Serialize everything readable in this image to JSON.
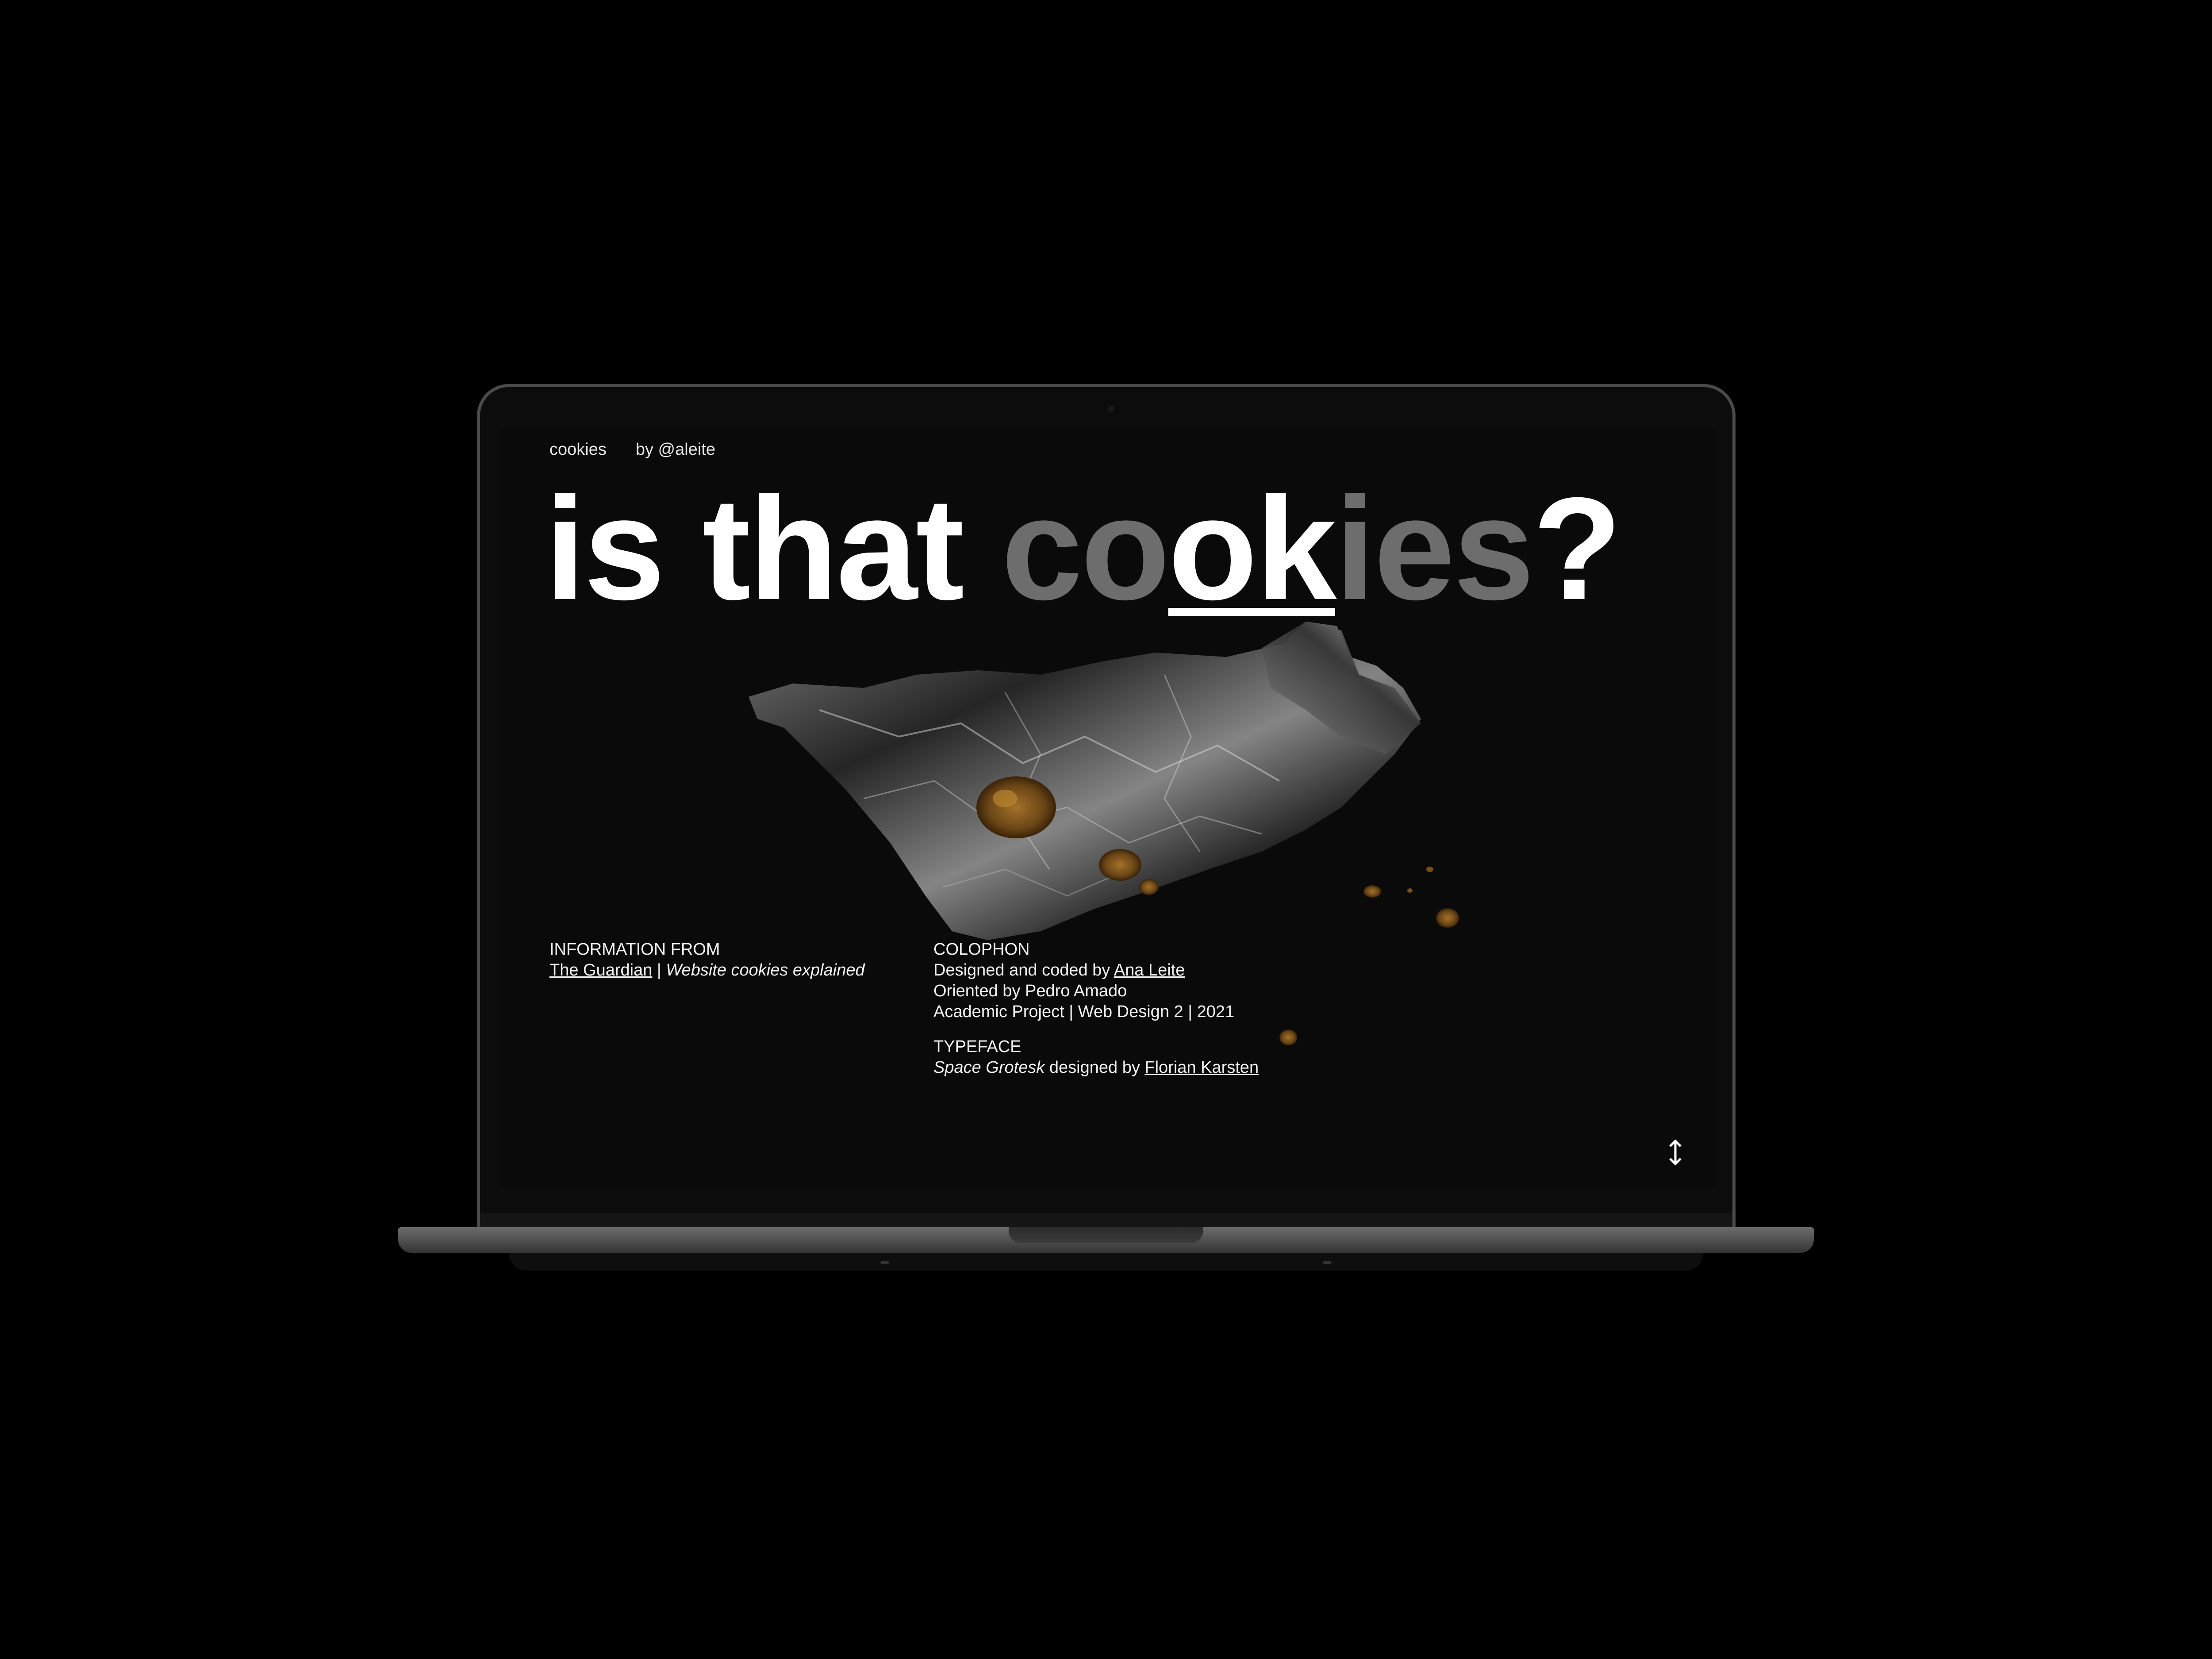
{
  "nav": {
    "site_name": "cookies",
    "author": "by @aleite"
  },
  "headline": {
    "part1": "is that ",
    "gray1": "co",
    "ok": "ok",
    "gray2": "ies",
    "end": "?"
  },
  "information": {
    "heading": "INFORMATION FROM",
    "source_link": "The Guardian",
    "separator": " | ",
    "article": "Website cookies explained"
  },
  "colophon": {
    "heading": "COLOPHON",
    "designed_prefix": "Designed and coded by ",
    "designer_link": "Ana Leite",
    "oriented": "Oriented by Pedro Amado",
    "project": "Academic Project | Web Design 2 | 2021"
  },
  "typeface": {
    "heading": "TYPEFACE",
    "font_name": "Space Grotesk",
    "designed_by": " designed by ",
    "designer_link": "Florian Karsten"
  },
  "icons": {
    "scroll": "vertical-arrows-icon"
  },
  "colors": {
    "background": "#0a0a0a",
    "text": "#ffffff",
    "muted": "#6d6d6d"
  }
}
